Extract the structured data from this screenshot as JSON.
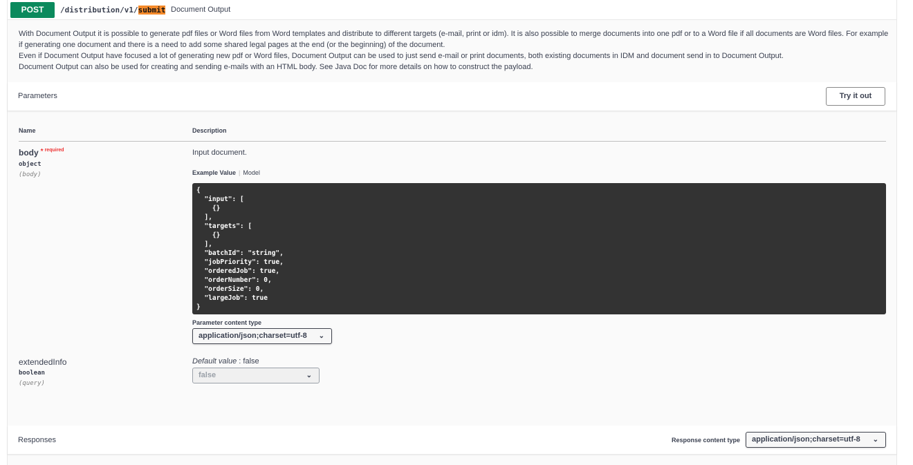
{
  "summary": {
    "method": "POST",
    "path_prefix": "/distribution/v1/",
    "path_highlight": "submit",
    "title": "Document Output"
  },
  "description": {
    "line1": "With Document Output it is possible to generate pdf files or Word files from Word templates and distribute to different targets (e-mail, print or idm). It is also possible to merge documents into one pdf or to a Word file if all documents are Word files. For example if generating one document and there is a need to add some shared legal pages at the end (or the beginning) of the document.",
    "line2": "Even if Document Output have focused a lot of generating new pdf or Word files, Document Output can be used to just send e-mail or print documents, both existing documents in IDM and document send in to Document Output.",
    "line3": "Document Output can also be used for creating and sending e-mails with an HTML body. See Java Doc for more details on how to construct the payload."
  },
  "parameters": {
    "title": "Parameters",
    "try_label": "Try it out",
    "col_name": "Name",
    "col_description": "Description",
    "body": {
      "name": "body",
      "star": "*",
      "required": "required",
      "type": "object",
      "in": "(body)",
      "description": "Input document.",
      "tab_example": "Example Value",
      "tab_model": "Model",
      "example": "{\n  \"input\": [\n    {}\n  ],\n  \"targets\": [\n    {}\n  ],\n  \"batchId\": \"string\",\n  \"jobPriority\": true,\n  \"orderedJob\": true,\n  \"orderNumber\": 0,\n  \"orderSize\": 0,\n  \"largeJob\": true\n}",
      "content_type_label": "Parameter content type",
      "content_type_value": "application/json;charset=utf-8"
    },
    "extended": {
      "name": "extendedInfo",
      "type": "boolean",
      "in": "(query)",
      "default_label": "Default value",
      "default_value": ": false",
      "select_value": "false"
    }
  },
  "responses": {
    "title": "Responses",
    "content_type_label": "Response content type",
    "content_type_value": "application/json;charset=utf-8"
  },
  "colors": {
    "post_green": "#0b8a5d",
    "highlight_orange": "#f58a2a",
    "code_bg": "#333333",
    "required_red": "#e33333"
  },
  "icons": [
    "chevron-down-icon"
  ]
}
